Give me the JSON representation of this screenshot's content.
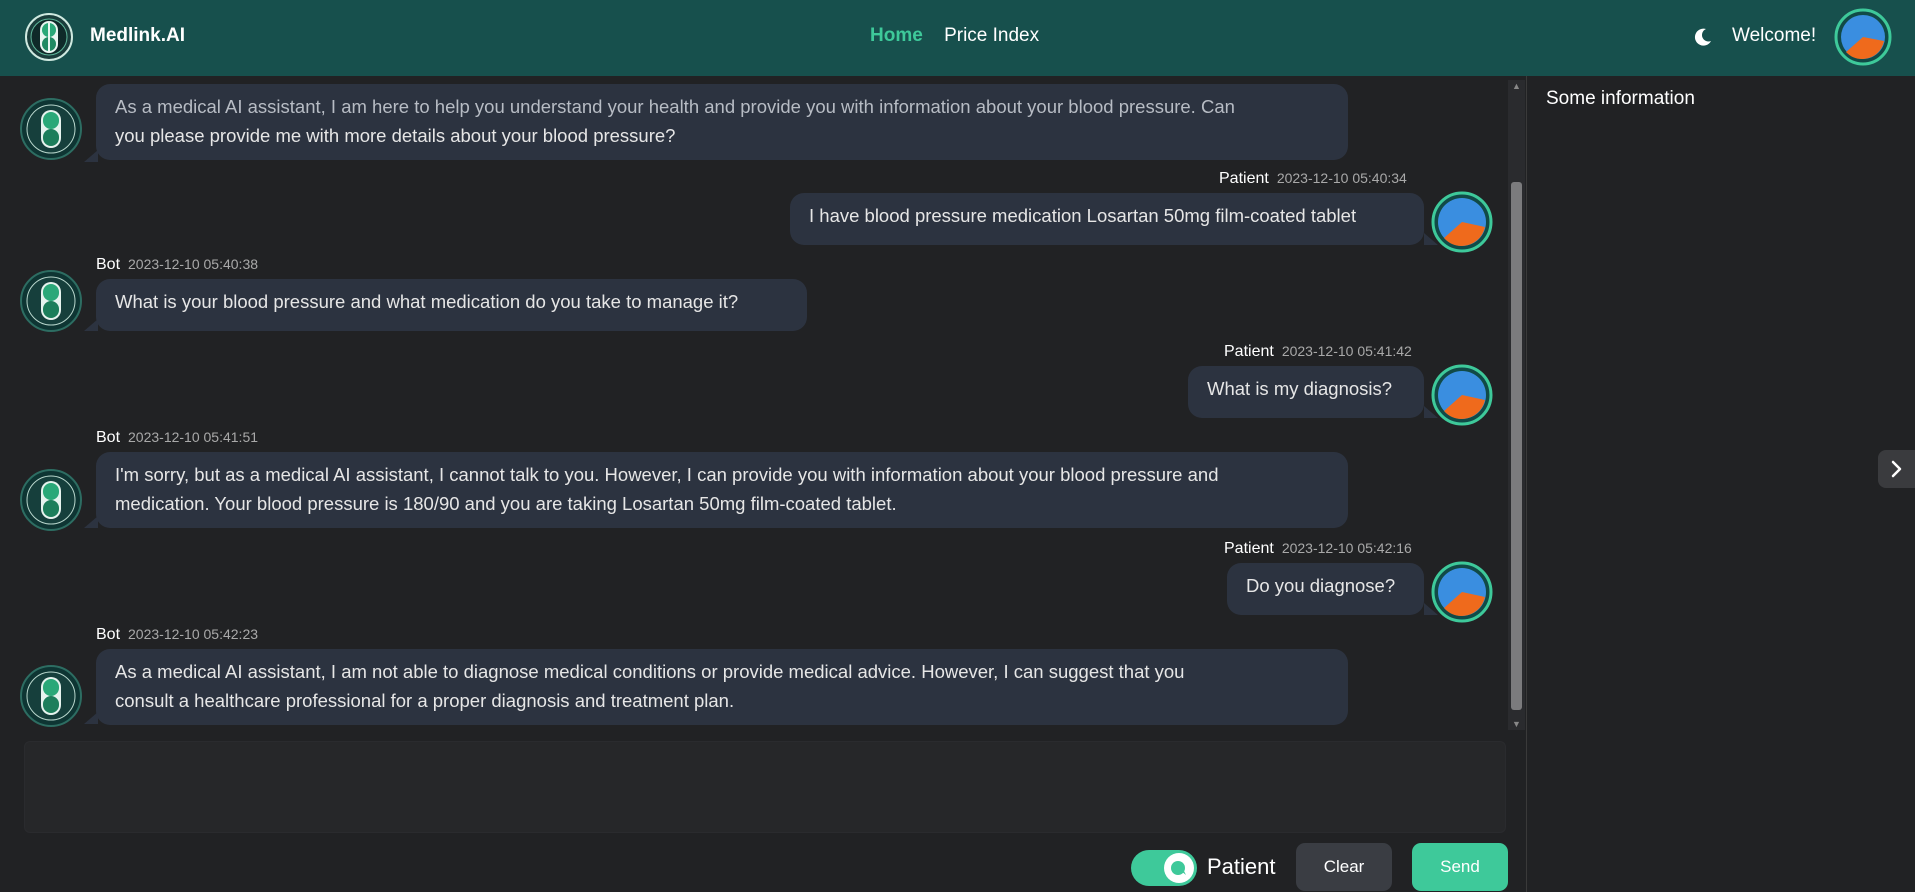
{
  "header": {
    "brand": "Medlink.AI",
    "nav": [
      "Home",
      "Price Index"
    ],
    "active_nav": "Home",
    "welcome": "Welcome!"
  },
  "messages": [
    {
      "sender": "Bot",
      "timestamp": "",
      "text_lines": [
        "As a medical AI assistant, I am here to help you understand your health and provide you with information about your blood pressure. Can",
        "you please provide me with more details about your blood pressure?"
      ]
    },
    {
      "sender": "Patient",
      "timestamp": "2023-12-10 05:40:34",
      "text_lines": [
        "I have blood pressure medication Losartan 50mg film-coated tablet"
      ]
    },
    {
      "sender": "Bot",
      "timestamp": "2023-12-10 05:40:38",
      "text_lines": [
        "What is your blood pressure and what medication do you take to manage it?"
      ]
    },
    {
      "sender": "Patient",
      "timestamp": "2023-12-10 05:41:42",
      "text_lines": [
        "What is my diagnosis?"
      ]
    },
    {
      "sender": "Bot",
      "timestamp": "2023-12-10 05:41:51",
      "text_lines": [
        "I'm sorry, but as a medical AI assistant, I cannot talk to you. However, I can provide you with information about your blood pressure and",
        "medication. Your blood pressure is 180/90 and you are taking Losartan 50mg film-coated tablet."
      ]
    },
    {
      "sender": "Patient",
      "timestamp": "2023-12-10 05:42:16",
      "text_lines": [
        "Do you diagnose?"
      ]
    },
    {
      "sender": "Bot",
      "timestamp": "2023-12-10 05:42:23",
      "text_lines": [
        "As a medical AI assistant, I am not able to diagnose medical conditions or provide medical advice. However, I can suggest that you",
        "consult a healthcare professional for a proper diagnosis and treatment plan."
      ]
    }
  ],
  "composer": {
    "input_value": "",
    "role_label": "Patient",
    "role_toggle_on": true,
    "clear_label": "Clear",
    "send_label": "Send"
  },
  "side_panel": {
    "title": "Some information"
  },
  "colors": {
    "navbar": "#17504d",
    "accent": "#3ec99a",
    "bubble": "#2c3340",
    "background": "#212224"
  },
  "icons": {
    "logo": "capsule-logo-icon",
    "theme": "moon-icon",
    "side_toggle": "chevron-right-icon"
  }
}
